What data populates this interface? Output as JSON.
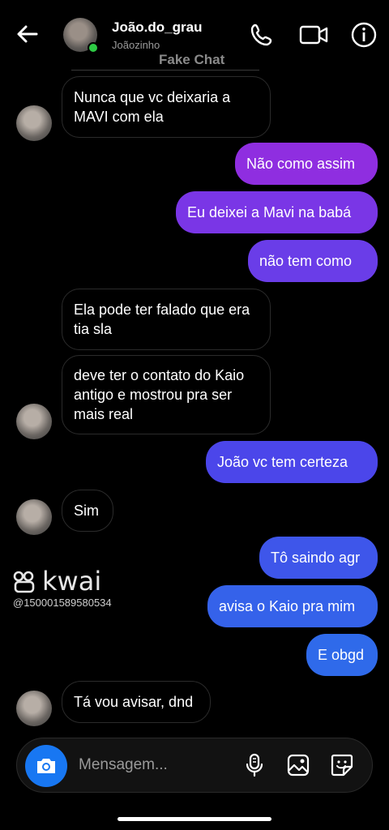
{
  "header": {
    "username": "João.do_grau",
    "subname": "Joãozinho",
    "watermark": "Fake Chat"
  },
  "messages": [
    {
      "side": "in",
      "text": "Nunca que vc deixaria a MAVI com ela"
    },
    {
      "side": "out",
      "text": "Não como assim"
    },
    {
      "side": "out",
      "text": "Eu deixei a Mavi na babá"
    },
    {
      "side": "out",
      "text": "não tem como"
    },
    {
      "side": "in",
      "text": "Ela pode ter falado que era tia sla"
    },
    {
      "side": "in",
      "text": "deve ter o contato do Kaio antigo e mostrou pra ser mais real"
    },
    {
      "side": "out",
      "text": "João vc tem certeza"
    },
    {
      "side": "in",
      "text": "Sim"
    },
    {
      "side": "out",
      "text": "Tô saindo agr"
    },
    {
      "side": "out",
      "text": "avisa o Kaio pra mim"
    },
    {
      "side": "out",
      "text": "E obgd"
    },
    {
      "side": "in",
      "text": "Tá vou avisar, dnd"
    }
  ],
  "kwai": {
    "word": "kwai",
    "id": "@150001589580534"
  },
  "composer": {
    "placeholder": "Mensagem..."
  },
  "icons": [
    "back-arrow-icon",
    "phone-icon",
    "video-icon",
    "info-icon",
    "camera-icon",
    "microphone-icon",
    "image-icon",
    "sticker-icon"
  ],
  "colors": {
    "bubble_purple": "#8a2be2",
    "bubble_blue": "#3858e8",
    "camera_blue": "#1877f2",
    "online_green": "#2ecb45"
  }
}
